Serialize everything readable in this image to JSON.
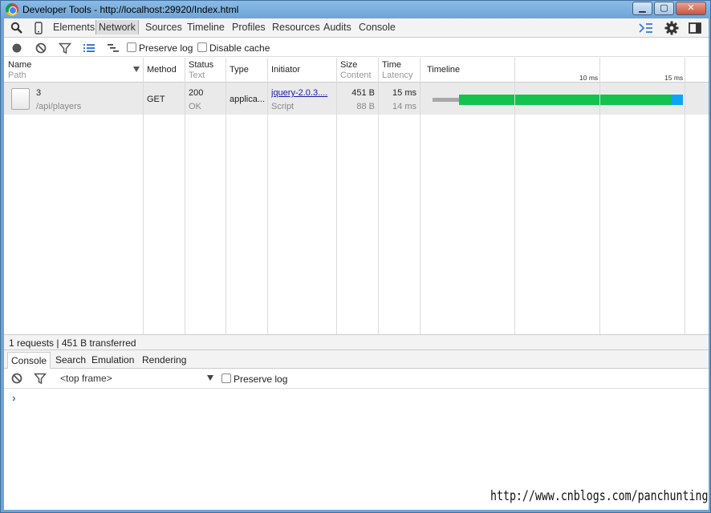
{
  "window": {
    "title": "Developer Tools - http://localhost:29920/Index.html",
    "minimize": "▁",
    "maximize": "▢",
    "close": "✕"
  },
  "main_tabs": [
    "Elements",
    "Network",
    "Sources",
    "Timeline",
    "Profiles",
    "Resources",
    "Audits",
    "Console"
  ],
  "selected_tab": "Network",
  "network_toolbar": {
    "preserve_log": "Preserve log",
    "disable_cache": "Disable cache"
  },
  "columns": {
    "name": "Name",
    "path": "Path",
    "method": "Method",
    "status": "Status",
    "text": "Text",
    "type": "Type",
    "initiator": "Initiator",
    "size": "Size",
    "content": "Content",
    "time": "Time",
    "latency": "Latency",
    "timeline": "Timeline"
  },
  "timeline_ticks": [
    "10 ms",
    "15 ms"
  ],
  "requests": [
    {
      "name": "3",
      "path": "/api/players",
      "method": "GET",
      "status": "200",
      "status_text": "OK",
      "type": "applica...",
      "initiator": "jquery-2.0.3....",
      "initiator_type": "Script",
      "size": "451 B",
      "content": "88 B",
      "time": "15 ms",
      "latency": "14 ms"
    }
  ],
  "summary": "1 requests | 451 B transferred",
  "drawer_tabs": [
    "Console",
    "Search",
    "Emulation",
    "Rendering"
  ],
  "console_toolbar": {
    "frame": "<top frame>",
    "preserve_log": "Preserve log"
  },
  "console_prompt": "›",
  "watermark": "http://www.cnblogs.com/panchunting",
  "colors": {
    "waiting": "#a8a8a8",
    "receiving": "#13c24f",
    "content_download": "#0da5ef",
    "accent": "#3b78d8"
  }
}
